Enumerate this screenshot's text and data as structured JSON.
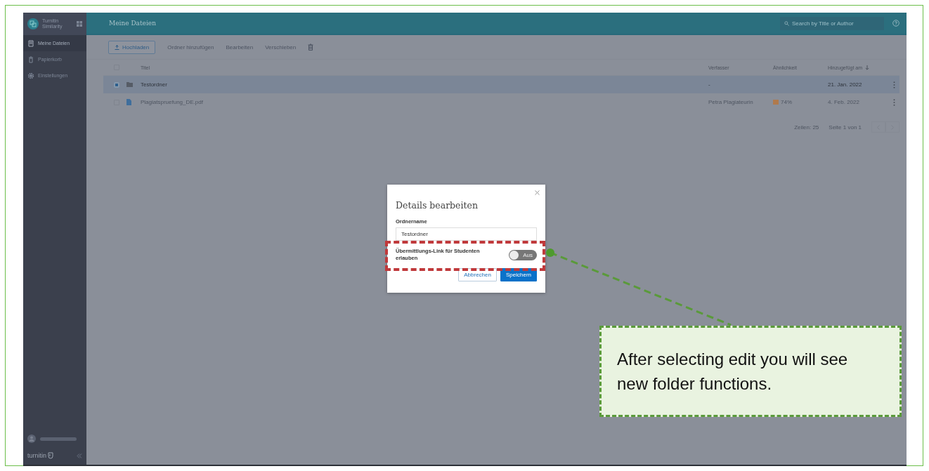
{
  "sidebar": {
    "brand": "Turnitin Similarity",
    "items": [
      {
        "label": "Meine Dateien",
        "kind": "files",
        "selected": true
      },
      {
        "label": "Papierkorb",
        "kind": "trash",
        "selected": false
      },
      {
        "label": "Einstellungen",
        "kind": "settings",
        "selected": false
      }
    ],
    "footer_logo": "turnitin"
  },
  "header": {
    "title": "Meine Dateien",
    "search": {
      "placeholder": "Search by Title or Author"
    }
  },
  "toolbar": {
    "upload": "Hochladen",
    "buttons": [
      "Ordner hinzufügen",
      "Bearbeiten",
      "Verschieben"
    ]
  },
  "table": {
    "select_all_checked": false,
    "columns": [
      "Titel",
      "Verfasser",
      "Ähnlichkeit",
      "Hinzugefügt am"
    ],
    "rows": [
      {
        "kind": "folder",
        "title": "Testordner",
        "author": "-",
        "date": "21. Jan. 2022",
        "selected": true
      },
      {
        "kind": "file",
        "title": "Plagiatspruefung_DE.pdf",
        "author": "Petra Plagiateurin",
        "similarity": "74%",
        "color": "#b07a4c",
        "date": "4. Feb. 2022",
        "selected": false
      }
    ]
  },
  "pagination": {
    "rows_per_page": "Zeilen: 25",
    "page": "Seite 1 von 1"
  },
  "dialog": {
    "title": "Details bearbeiten",
    "field_label": "Ordnername",
    "field_value": "Testordner",
    "toggle_label": "Übermittlungs-Link für Studenten erlauben",
    "toggle": {
      "on": false,
      "state_text": "Aus"
    },
    "buttons": [
      {
        "label": "Abbrechen",
        "kind": "secondary"
      },
      {
        "label": "Speichern",
        "kind": "primary"
      }
    ]
  },
  "callout": {
    "text": "After selecting edit you will see new folder functions."
  }
}
